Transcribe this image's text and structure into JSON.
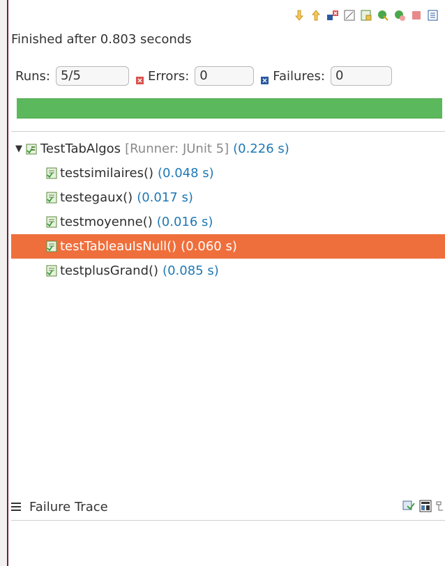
{
  "toolbar": {
    "icons": [
      "next-failure-icon",
      "previous-failure-icon",
      "show-failures-only-icon",
      "scroll-lock-icon",
      "show-skipped-only-icon",
      "rerun-test-icon",
      "rerun-failed-first-icon",
      "stop-icon",
      "test-run-history-icon",
      "history-dropdown-icon",
      "view-menu-icon"
    ]
  },
  "status": {
    "text": "Finished after 0.803 seconds"
  },
  "counters": {
    "runs_label": "Runs:",
    "runs_value": "5/5",
    "errors_label": "Errors:",
    "errors_value": "0",
    "failures_label": "Failures:",
    "failures_value": "0"
  },
  "progress": {
    "fraction": 1.0,
    "color": "#5cb85c"
  },
  "tree": {
    "suite": {
      "name": "TestTabAlgos",
      "runner": "[Runner: JUnit 5]",
      "time": "(0.226 s)"
    },
    "tests": [
      {
        "name": "testsimilaires()",
        "time": "(0.048 s)"
      },
      {
        "name": "testegaux()",
        "time": "(0.017 s)"
      },
      {
        "name": "testmoyenne()",
        "time": "(0.016 s)"
      },
      {
        "name": "testTableauIsNull()",
        "time": "(0.060 s)",
        "selected": true
      },
      {
        "name": "testplusGrand()",
        "time": "(0.085 s)"
      }
    ]
  },
  "trace": {
    "label": "Failure Trace"
  },
  "colors": {
    "selection": "#ef6f3c",
    "time": "#1f78b4",
    "error": "#d9534f",
    "failure": "#2a5aa0"
  }
}
